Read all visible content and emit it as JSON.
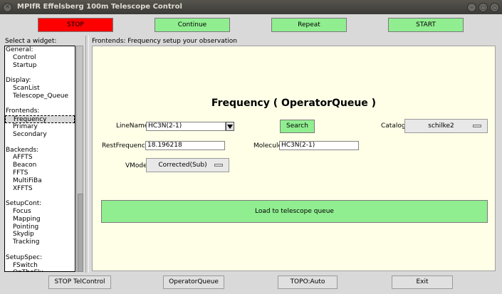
{
  "window": {
    "title": "MPIfR Effelsberg 100m Telescope Control"
  },
  "toolbar": {
    "stop": "STOP",
    "continue": "Continue",
    "repeat": "Repeat",
    "start": "START"
  },
  "sidebar": {
    "label": "Select a widget:",
    "rows": [
      {
        "text": "General:",
        "item": false
      },
      {
        "text": "Control",
        "item": true
      },
      {
        "text": "Startup",
        "item": true
      },
      {
        "text": "",
        "item": false
      },
      {
        "text": "Display:",
        "item": false
      },
      {
        "text": "ScanList",
        "item": true
      },
      {
        "text": "Telescope_Queue",
        "item": true
      },
      {
        "text": "",
        "item": false
      },
      {
        "text": "Frontends:",
        "item": false
      },
      {
        "text": "Frequency",
        "item": true,
        "selected": true
      },
      {
        "text": "Primary",
        "item": true
      },
      {
        "text": "Secondary",
        "item": true
      },
      {
        "text": "",
        "item": false
      },
      {
        "text": "Backends:",
        "item": false
      },
      {
        "text": "AFFTS",
        "item": true
      },
      {
        "text": "Beacon",
        "item": true
      },
      {
        "text": "FFTS",
        "item": true
      },
      {
        "text": "MultiFiBa",
        "item": true
      },
      {
        "text": "XFFTS",
        "item": true
      },
      {
        "text": "",
        "item": false
      },
      {
        "text": "SetupCont:",
        "item": false
      },
      {
        "text": "Focus",
        "item": true
      },
      {
        "text": "Mapping",
        "item": true
      },
      {
        "text": "Pointing",
        "item": true
      },
      {
        "text": "Skydip",
        "item": true
      },
      {
        "text": "Tracking",
        "item": true
      },
      {
        "text": "",
        "item": false
      },
      {
        "text": "SetupSpec:",
        "item": false
      },
      {
        "text": "FSwitch",
        "item": true
      },
      {
        "text": "OnTheFly",
        "item": true
      }
    ]
  },
  "main": {
    "header": "Frontends: Frequency   setup your observation",
    "title": "Frequency ( OperatorQueue )",
    "linename_label": "LineName",
    "linename_value": "HC3N(2-1)",
    "search_label": "Search",
    "catalog_label": "Catalog",
    "catalog_value": "schilke2",
    "restfreq_label": "RestFrequency",
    "restfreq_value": "18.196218",
    "molecule_label": "Molecule",
    "molecule_value": "HC3N(2-1)",
    "vmode_label": "VMode",
    "vmode_value": "Corrected(Sub)",
    "load_label": "Load to telescope queue"
  },
  "bottom": {
    "stop_tel": "STOP TelControl",
    "operator_queue": "OperatorQueue",
    "topo": "TOPO:Auto",
    "exit": "Exit"
  },
  "colors": {
    "green": "#90ee90",
    "red": "#ff0000",
    "panel": "#ffffe8"
  }
}
